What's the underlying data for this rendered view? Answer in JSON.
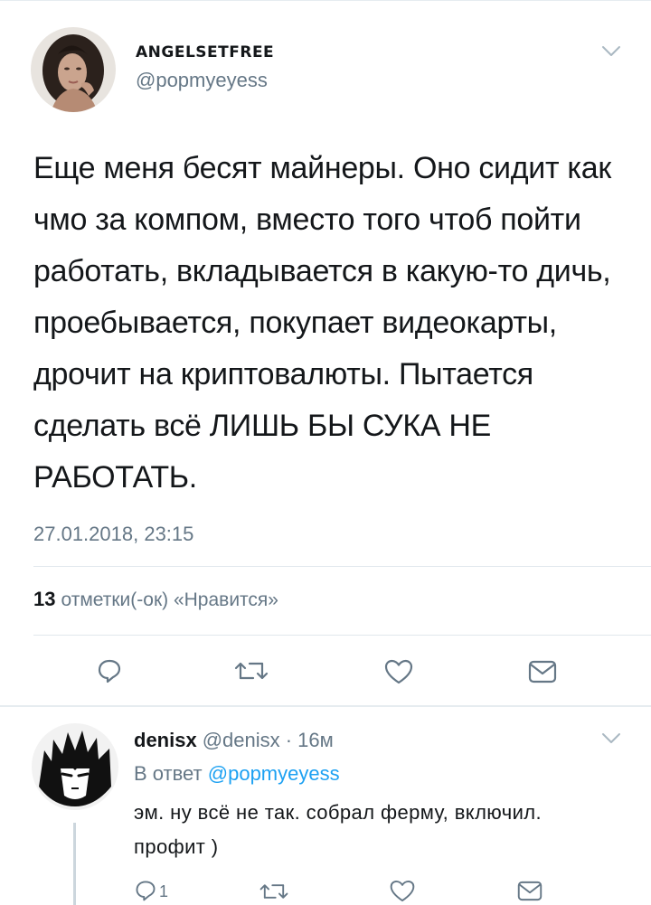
{
  "tweet": {
    "display_name": "ANGELSETFREE",
    "handle": "@popmyeyess",
    "text": "Еще меня бесят майнеры. Оно сидит как чмо за компом, вместо того чтоб пойти работать, вкладывается в какую-то дичь, проебывается, покупает видеокарты, дрочит на криптовалюты. Пытается сделать всё ЛИШЬ БЫ СУКА НЕ РАБОТАТЬ.",
    "timestamp": "27.01.2018, 23:15",
    "likes_count": "13",
    "likes_label": "отметки(-ок) «Нравится»",
    "actions": [
      "reply-icon",
      "retweet-icon",
      "like-icon",
      "message-icon"
    ]
  },
  "reply": {
    "display_name": "denisx",
    "handle_time": "@denisx · 16м",
    "reply_to_prefix": "В ответ",
    "reply_to_handle": "@popmyeyess",
    "text": "эм. ну всё не так. собрал ферму, включил. профит )",
    "reply_count": "1",
    "actions": [
      "reply-icon",
      "retweet-icon",
      "like-icon",
      "message-icon"
    ]
  },
  "colors": {
    "text": "#14171a",
    "secondary": "#657786",
    "link": "#1da1f2",
    "divider": "#e1e8ed"
  }
}
